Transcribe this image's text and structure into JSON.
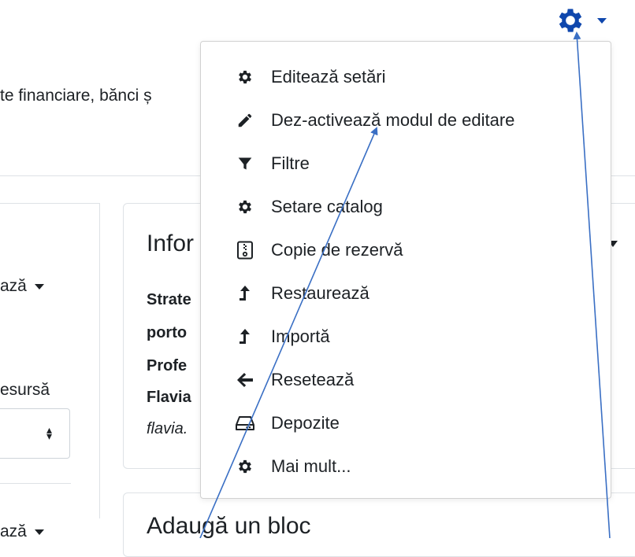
{
  "header": {
    "settings_icon": "gear-icon",
    "accent_color": "#0f47ad"
  },
  "course": {
    "subtitle_fragment": "te financiare, bănci ș"
  },
  "left_column": {
    "text1": "ază",
    "text2": "esursă",
    "text3": "ază"
  },
  "info_block": {
    "title": "Infor",
    "lines": [
      "Strate",
      "porto",
      "Profe",
      "Flavia"
    ],
    "italic": "flavia."
  },
  "add_block": {
    "title": "Adaugă un bloc"
  },
  "menu": {
    "items": [
      {
        "label": "Editează setări",
        "icon": "gear-icon"
      },
      {
        "label": "Dez-activează modul de editare",
        "icon": "pencil-icon"
      },
      {
        "label": "Filtre",
        "icon": "filter-icon"
      },
      {
        "label": "Setare catalog",
        "icon": "gear-icon"
      },
      {
        "label": "Copie de rezervă",
        "icon": "archive-file-icon"
      },
      {
        "label": "Restaurează",
        "icon": "level-up-icon"
      },
      {
        "label": "Importă",
        "icon": "level-up-icon"
      },
      {
        "label": "Resetează",
        "icon": "arrow-left-icon"
      },
      {
        "label": "Depozite",
        "icon": "hdd-icon"
      },
      {
        "label": "Mai mult...",
        "icon": "gear-icon"
      }
    ]
  }
}
